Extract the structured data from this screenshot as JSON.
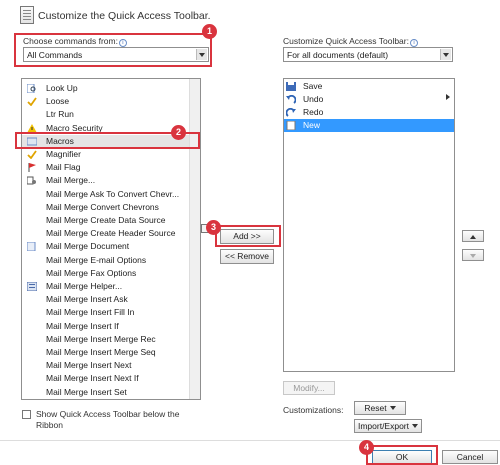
{
  "title": "Customize the Quick Access Toolbar.",
  "left": {
    "choose_label": "Choose commands from:",
    "choose_value": "All Commands",
    "commands": [
      {
        "label": "Look Up",
        "icon": "lookup-icon"
      },
      {
        "label": "Loose",
        "icon": "check-icon"
      },
      {
        "label": "Ltr Run",
        "icon": ""
      },
      {
        "label": "Macro Security",
        "icon": "warning-icon"
      },
      {
        "label": "Macros",
        "icon": "macros-icon"
      },
      {
        "label": "Magnifier",
        "icon": "check-icon"
      },
      {
        "label": "Mail Flag",
        "icon": "flag-icon"
      },
      {
        "label": "Mail Merge...",
        "icon": "mail-merge-icon"
      },
      {
        "label": "Mail Merge Ask To Convert Chevr...",
        "icon": ""
      },
      {
        "label": "Mail Merge Convert Chevrons",
        "icon": ""
      },
      {
        "label": "Mail Merge Create Data Source",
        "icon": ""
      },
      {
        "label": "Mail Merge Create Header Source",
        "icon": ""
      },
      {
        "label": "Mail Merge Document",
        "icon": "document-icon"
      },
      {
        "label": "Mail Merge E-mail Options",
        "icon": ""
      },
      {
        "label": "Mail Merge Fax Options",
        "icon": ""
      },
      {
        "label": "Mail Merge Helper...",
        "icon": "helper-icon"
      },
      {
        "label": "Mail Merge Insert Ask",
        "icon": ""
      },
      {
        "label": "Mail Merge Insert Fill In",
        "icon": ""
      },
      {
        "label": "Mail Merge Insert If",
        "icon": ""
      },
      {
        "label": "Mail Merge Insert Merge Rec",
        "icon": ""
      },
      {
        "label": "Mail Merge Insert Merge Seq",
        "icon": ""
      },
      {
        "label": "Mail Merge Insert Next",
        "icon": ""
      },
      {
        "label": "Mail Merge Insert Next If",
        "icon": ""
      },
      {
        "label": "Mail Merge Insert Set",
        "icon": ""
      }
    ],
    "selected_command": "Macros",
    "show_below_label": "Show Quick Access Toolbar below the Ribbon"
  },
  "middle": {
    "add_label": "Add >>",
    "remove_label": "<< Remove"
  },
  "right": {
    "customize_label": "Customize Quick Access Toolbar:",
    "customize_value": "For all documents (default)",
    "items": [
      {
        "label": "Save",
        "icon": "save-icon"
      },
      {
        "label": "Undo",
        "icon": "undo-icon"
      },
      {
        "label": "Redo",
        "icon": "redo-icon"
      },
      {
        "label": "New",
        "icon": "new-document-icon"
      }
    ],
    "selected_item": "New",
    "modify_label": "Modify...",
    "customizations_label": "Customizations:",
    "reset_label": "Reset",
    "import_export_label": "Import/Export"
  },
  "footer": {
    "ok_label": "OK",
    "cancel_label": "Cancel"
  },
  "callouts": [
    "1",
    "2",
    "3",
    "4"
  ],
  "colors": {
    "accent": "#3399ff",
    "callout": "#d9343e",
    "selection": "#3399ff"
  }
}
